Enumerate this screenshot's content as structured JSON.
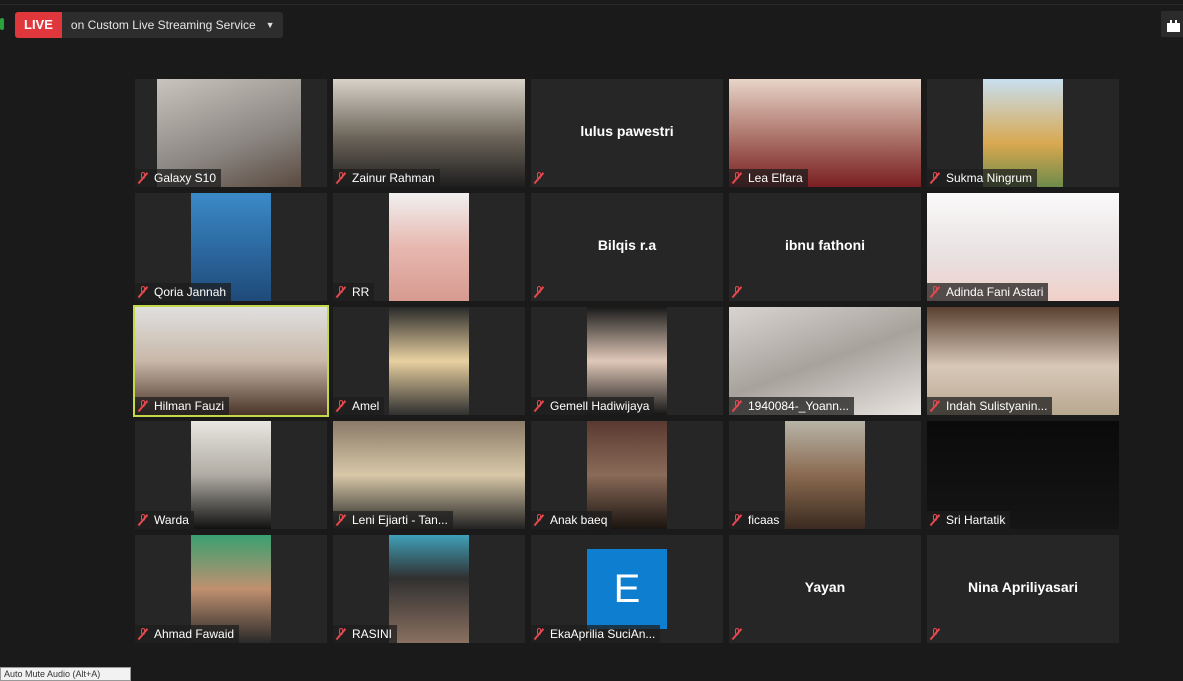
{
  "stream": {
    "live_label": "LIVE",
    "service": "on Custom Live Streaming Service"
  },
  "tooltip": "Auto Mute Audio (Alt+A)",
  "colors": {
    "live": "#e0373d",
    "active_speaker": "#c4d94a",
    "muted": "#e5484d"
  },
  "participants": [
    {
      "name": "Galaxy S10",
      "video": true
    },
    {
      "name": "Zainur Rahman",
      "video": true
    },
    {
      "name": "lulus pawestri",
      "video": false
    },
    {
      "name": "Lea Elfara",
      "video": true
    },
    {
      "name": "Sukma Ningrum",
      "video": true
    },
    {
      "name": "Qoria Jannah",
      "video": true
    },
    {
      "name": "RR",
      "video": true
    },
    {
      "name": "Bilqis r.a",
      "video": false
    },
    {
      "name": "ibnu fathoni",
      "video": false
    },
    {
      "name": "Adinda Fani Astari",
      "video": true
    },
    {
      "name": "Hilman Fauzi",
      "video": true,
      "active": true
    },
    {
      "name": "Amel",
      "video": true
    },
    {
      "name": "Gemell Hadiwijaya",
      "video": true
    },
    {
      "name": "1940084-_Yoann...",
      "video": true
    },
    {
      "name": "Indah Sulistyanin...",
      "video": true
    },
    {
      "name": "Warda",
      "video": true
    },
    {
      "name": "Leni Ejiarti - Tan...",
      "video": true
    },
    {
      "name": "Anak baeq",
      "video": true
    },
    {
      "name": "ficaas",
      "video": true
    },
    {
      "name": "Sri Hartatik",
      "video": true
    },
    {
      "name": "Ahmad Fawaid",
      "video": true
    },
    {
      "name": "RASINI",
      "video": true
    },
    {
      "name": "EkaAprilia SuciAn...",
      "video": false,
      "avatar_letter": "E"
    },
    {
      "name": "Yayan",
      "video": false
    },
    {
      "name": "Nina Apriliyasari",
      "video": false
    }
  ]
}
